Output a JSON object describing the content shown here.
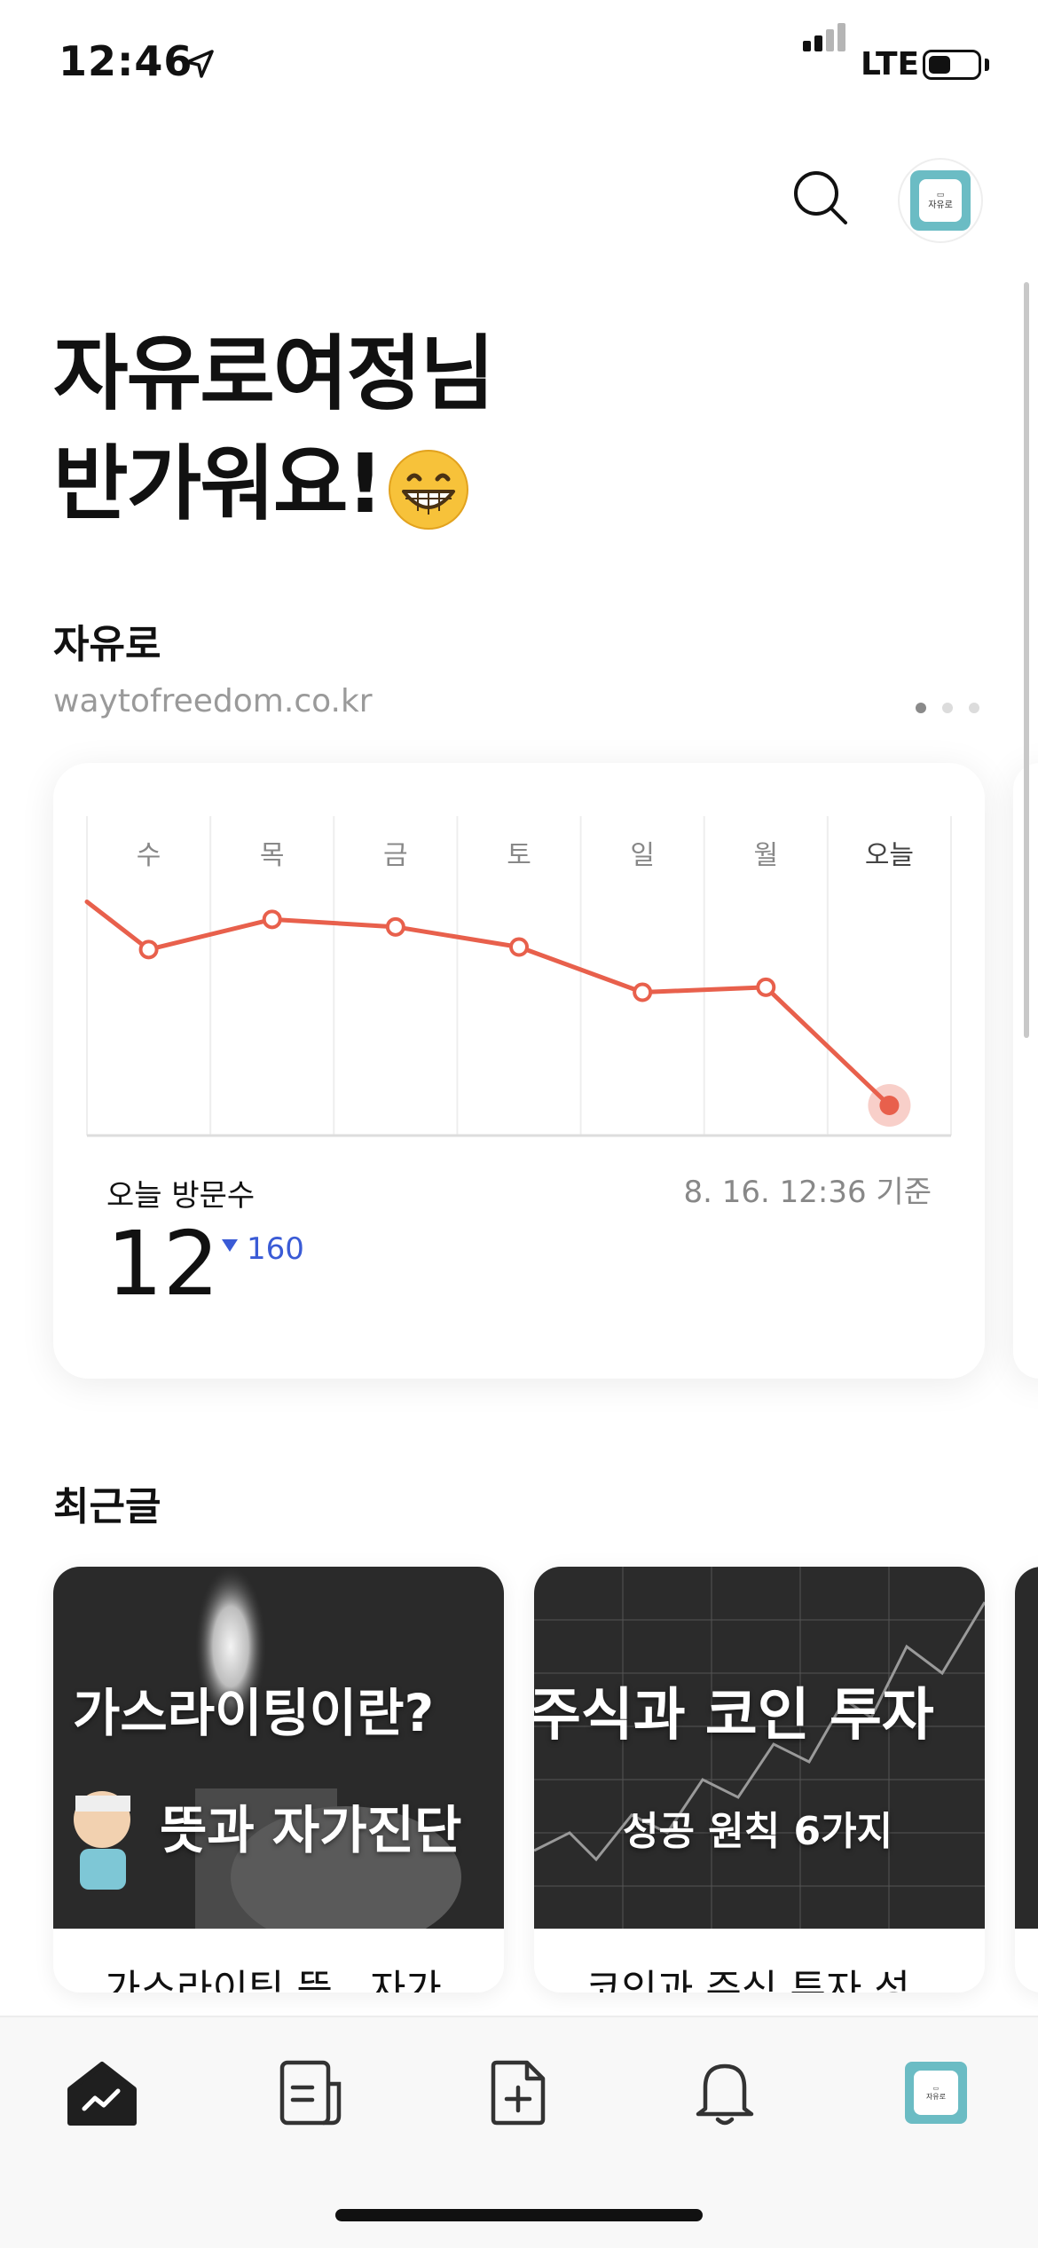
{
  "status_bar": {
    "time": "12:46",
    "network": "LTE",
    "battery_level": 0.45
  },
  "header": {
    "avatar_text": "자유로"
  },
  "greeting": {
    "line1": "자유로여정님",
    "line2": "반가워요!"
  },
  "blog": {
    "name": "자유로",
    "url": "waytofreedom.co.kr",
    "page_index": 0,
    "page_count": 3
  },
  "stats": {
    "visits_label": "오늘 방문수",
    "updated_at": "8. 16. 12:36 기준",
    "visits_count": "12",
    "visits_change": "160",
    "visits_change_direction": "down"
  },
  "chart_data": {
    "type": "line",
    "categories": [
      "수",
      "목",
      "금",
      "토",
      "일",
      "월",
      "오늘"
    ],
    "values": [
      154,
      166,
      163,
      155,
      137,
      139,
      92
    ],
    "ylim": [
      80,
      200
    ],
    "grid": true,
    "color": "#e8604c"
  },
  "recent": {
    "title": "최근글",
    "posts": [
      {
        "title": "가스라이팅 뜻 , 자가",
        "thumb_line1": "가스라이팅이란?",
        "thumb_line2": "뜻과 자가진단"
      },
      {
        "title": "코인과 주식 투자 성",
        "thumb_line1": "주식과 코인 투자",
        "thumb_line2": "성공 원칙 6가지"
      }
    ]
  },
  "tab_bar": {
    "items": [
      "home-stats-icon",
      "posts-icon",
      "new-post-icon",
      "notifications-icon",
      "profile-avatar"
    ],
    "active_index": 0
  }
}
